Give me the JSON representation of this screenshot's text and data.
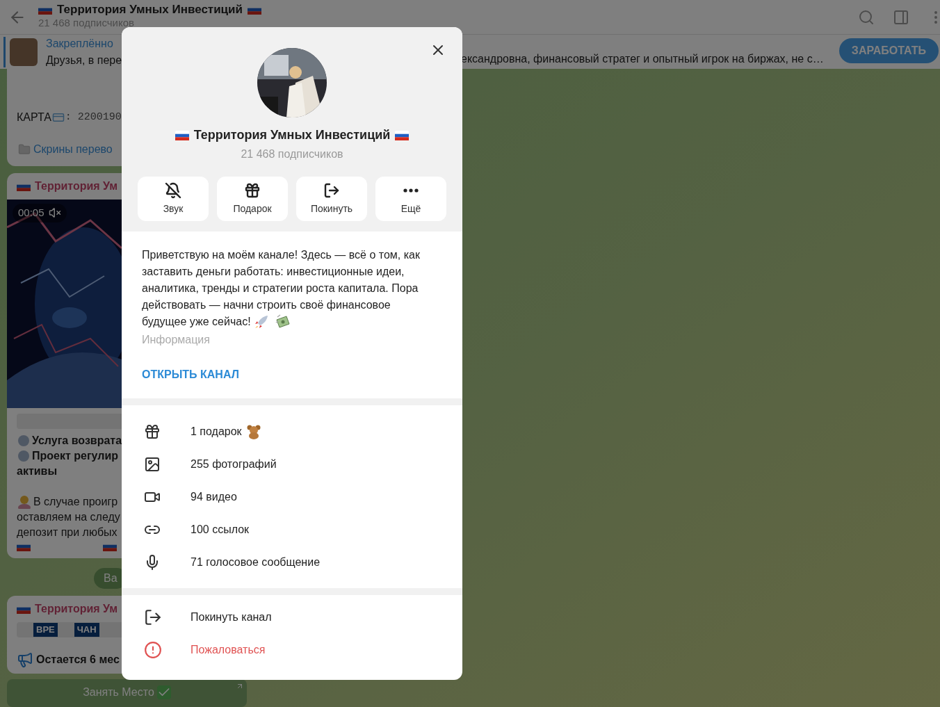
{
  "header": {
    "title": "Территория Умных Инвестиций",
    "subtitle": "21 468 подписчиков"
  },
  "pinned": {
    "label": "Закреплённо",
    "text_left": "Друзья, в пере",
    "text_right": "ександровна, финансовый стратег и опытный игрок на биржах, не с…",
    "button": "ЗАРАБОТАТЬ"
  },
  "messages": {
    "card_label": "КАРТА",
    "card_number": ": 2200190",
    "screens_link": "Скрины перево",
    "sender": "Территория Ум",
    "duration": "00:05",
    "bold_lines": [
      "Услуга возврата",
      "Проект регулир",
      "активы"
    ],
    "lines": [
      "В случае проигр",
      "оставляем на следу",
      "депозит при любых"
    ],
    "service": "Ва",
    "sender_2": "Территория Ум",
    "strip": [
      "ВРЕ",
      "ЧАН"
    ],
    "seats": "Остается 6 мес",
    "inline_button": "Занять Место"
  },
  "modal": {
    "title": "Территория Умных Инвестиций",
    "subtitle": "21 468 подписчиков",
    "actions": [
      "Звук",
      "Подарок",
      "Покинуть",
      "Ещё"
    ],
    "description_lines": [
      "Приветствую на моём канале! Здесь — всё о том, как",
      "заставить деньги работать: инвестиционные идеи,",
      "аналитика, тренды и стратегии роста капитала. Пора",
      "действовать — начни строить своё финансовое",
      "будущее уже сейчас!"
    ],
    "info_label": "Информация",
    "open_link": "ОТКРЫТЬ КАНАЛ",
    "media": [
      "1 подарок",
      "255 фотографий",
      "94 видео",
      "100 ссылок",
      "71 голосовое сообщение"
    ],
    "bottom": [
      {
        "kind": "leave",
        "label": "Покинуть канал"
      },
      {
        "kind": "report",
        "label": "Пожаловаться"
      }
    ]
  }
}
